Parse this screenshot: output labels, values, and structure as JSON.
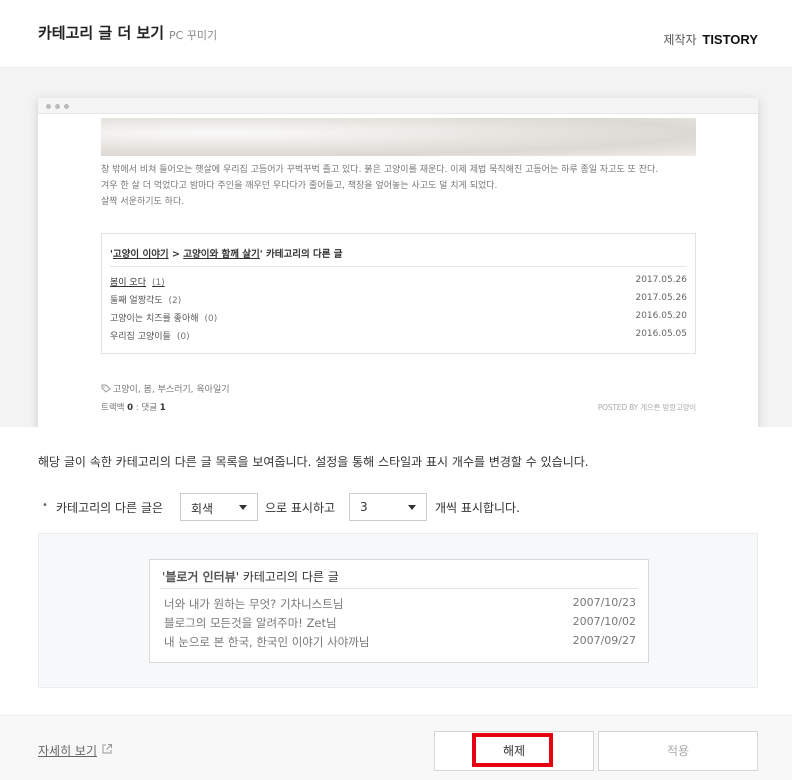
{
  "header": {
    "title": "카테고리 글 더 보기",
    "subtitle": "PC 꾸미기",
    "maker_label": "제작자",
    "maker_name": "TISTORY"
  },
  "preview": {
    "story_lines": [
      "창 밖에서 비쳐 들어오는 햇살에 우리집 고등어가 꾸벅꾸벅 졸고 있다. 붉은 고양이를 재운다. 이제 제법 묵직해진 고등어는 하루 종일 자고도 또 잔다.",
      "겨우 한 살 더 먹었다고 밤마다 주인을 깨우던 우다다가 줄어들고, 책장을 엎어놓는 사고도 덜 치게 되었다.",
      "살짝 서운하기도 하다."
    ],
    "related": {
      "title_quote_open": "'",
      "title_category1": "고양이 이야기",
      "title_arrow": " > ",
      "title_category2": "고양이와 함께 살기",
      "title_suffix": "' 카테고리의 다른 글",
      "items": [
        {
          "title": "봄이 오다",
          "count": "(1)",
          "date": "2017.05.26"
        },
        {
          "title": "둘째 얼짱각도",
          "count": "(2)",
          "date": "2017.05.26"
        },
        {
          "title": "고양이는 치즈를 좋아해",
          "count": "(0)",
          "date": "2016.05.20"
        },
        {
          "title": "우리집 고양이들",
          "count": "(0)",
          "date": "2016.05.05"
        }
      ]
    },
    "tags": "고양이, 봄, 부스러기, 육아일기",
    "trackback_label": "트랙백",
    "trackback_count": "0",
    "comment_label": "댓글",
    "comment_count": "1",
    "posted_by": "POSTED BY 게으른 방랑고양이"
  },
  "description": "해당 글이 속한 카테고리의 다른 글 목록을 보여줍니다. 설정을 통해 스타일과 표시 개수를 변경할 수 있습니다.",
  "settings": {
    "bullet": "•",
    "label_before": "카테고리의 다른 글은",
    "style_value": "회색",
    "label_middle": "으로 표시하고",
    "count_value": "3",
    "label_after": "개씩 표시합니다."
  },
  "sample": {
    "title_quote_open": "'",
    "title_name": "블로거 인터뷰",
    "title_suffix": "' 카테고리의 다른 글",
    "items": [
      {
        "title": "너와 내가 원하는 무엇? 기차니스트님",
        "date": "2007/10/23"
      },
      {
        "title": "블로그의 모든것을 알려주마! Zet님",
        "date": "2007/10/02"
      },
      {
        "title": "내 눈으로 본 한국, 한국인 이야기 사야까님",
        "date": "2007/09/27"
      }
    ]
  },
  "footer": {
    "more_link": "자세히 보기",
    "release_button": "해제",
    "apply_button": "적용"
  },
  "colors": {
    "highlight": "#e60012",
    "page_bg": "#ffffff",
    "preview_bg": "#f3f3f3",
    "sample_bg": "#f7f8f9"
  }
}
